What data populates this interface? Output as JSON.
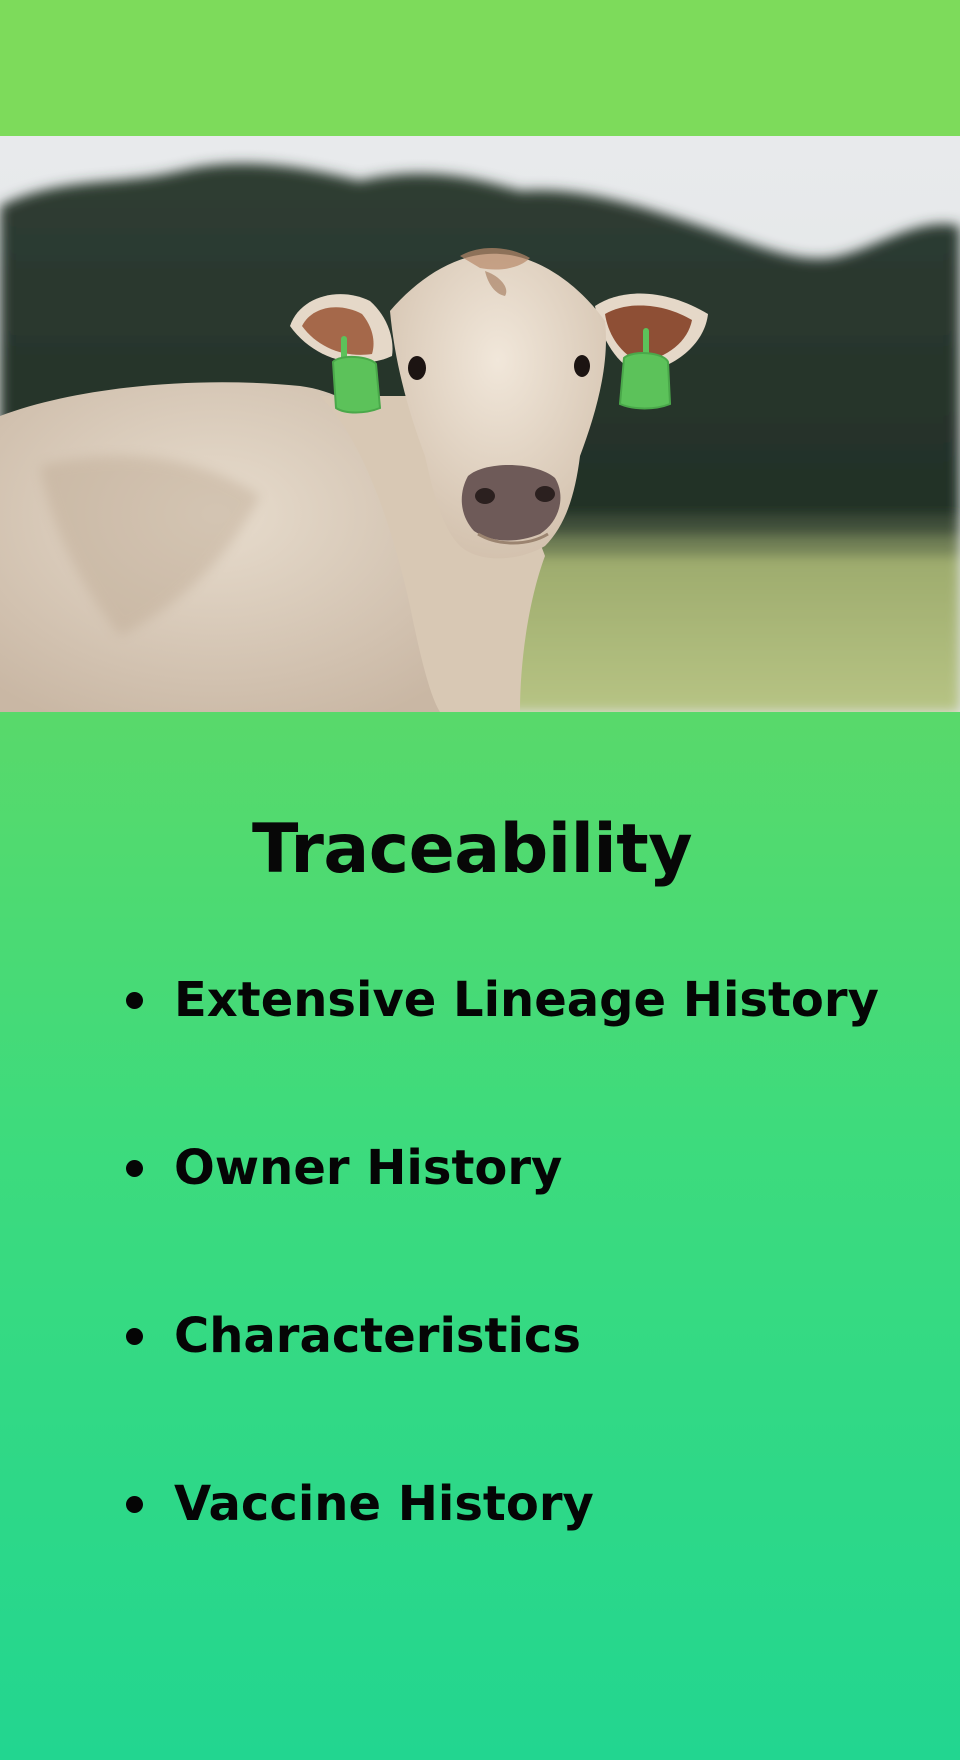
{
  "hero": {
    "image": "white-cow-with-green-ear-tags-photo"
  },
  "heading": {
    "title": "Traceability"
  },
  "features": [
    {
      "label": "Extensive Lineage History"
    },
    {
      "label": "Owner History"
    },
    {
      "label": "Characteristics"
    },
    {
      "label": "Vaccine History"
    }
  ],
  "colors": {
    "top_band": "#7ddb5b",
    "gradient_start": "#59d96a",
    "gradient_end": "#22d690",
    "text": "#050505",
    "ear_tag": "#5cc25a"
  }
}
